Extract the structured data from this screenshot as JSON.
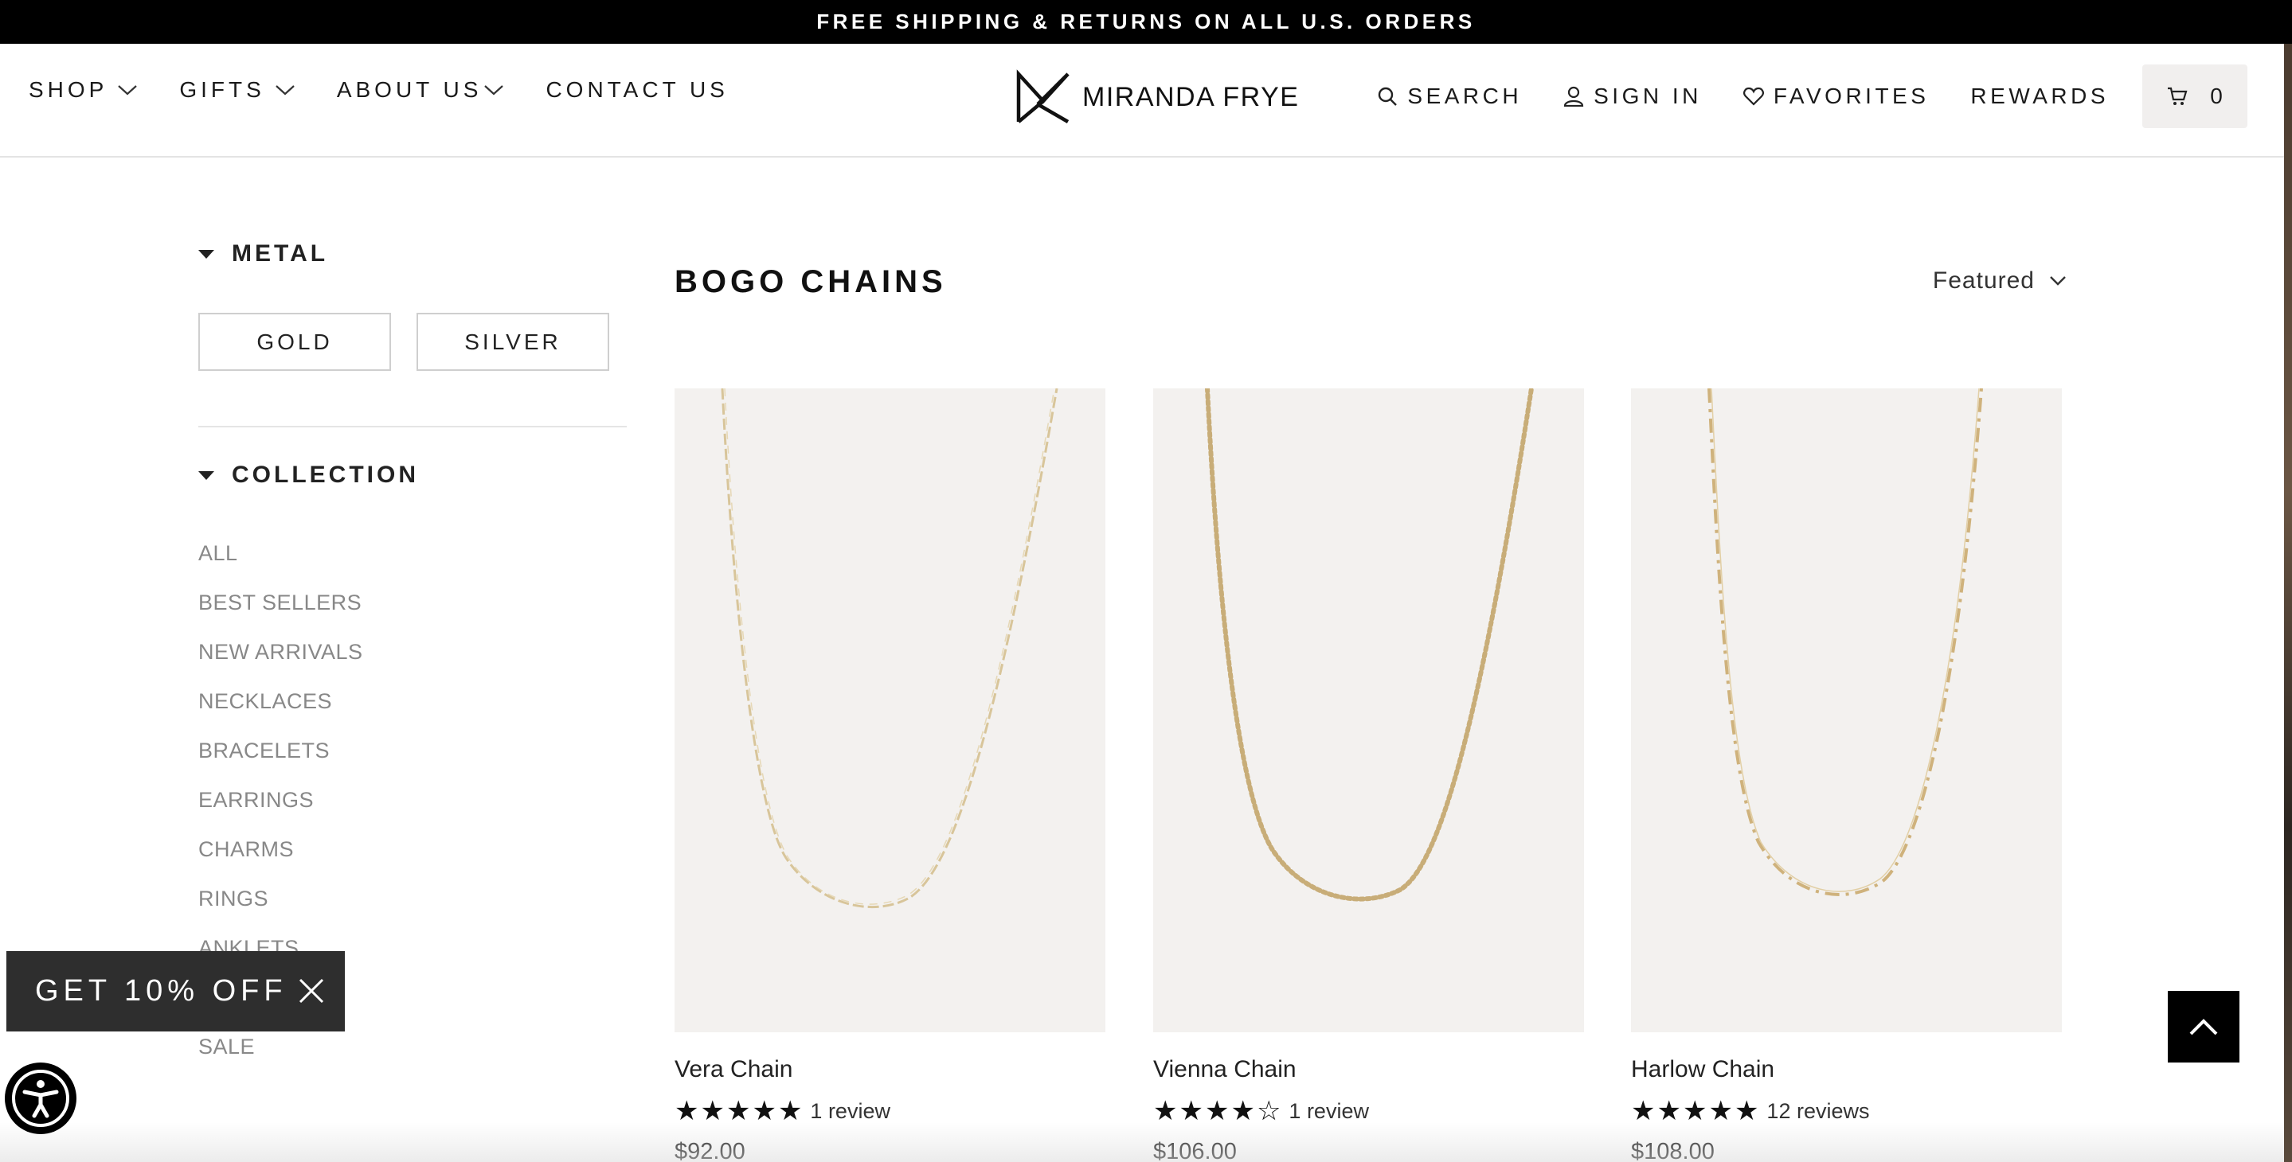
{
  "announcement": "FREE SHIPPING & RETURNS ON ALL U.S. ORDERS",
  "nav_left": [
    {
      "label": "SHOP",
      "has_dropdown": true
    },
    {
      "label": "GIFTS",
      "has_dropdown": true
    },
    {
      "label": "ABOUT US",
      "has_dropdown": true
    },
    {
      "label": "CONTACT US",
      "has_dropdown": false
    }
  ],
  "brand": {
    "name": "MIRANDA FRYE",
    "logo_icon": "mf-monogram-icon"
  },
  "nav_right": {
    "search": "SEARCH",
    "sign_in": "SIGN IN",
    "favorites": "FAVORITES",
    "rewards": "REWARDS",
    "cart_count": "0"
  },
  "filters": {
    "metal": {
      "title": "METAL",
      "options": [
        "GOLD",
        "SILVER"
      ]
    },
    "collection": {
      "title": "COLLECTION",
      "items": [
        "ALL",
        "BEST SELLERS",
        "NEW ARRIVALS",
        "NECKLACES",
        "BRACELETS",
        "EARRINGS",
        "CHARMS",
        "RINGS",
        "ANKLETS",
        "",
        "SALE"
      ]
    }
  },
  "main": {
    "title": "BOGO CHAINS",
    "sort_label": "Featured"
  },
  "products": [
    {
      "name": "Vera Chain",
      "rating": 5,
      "reviews": "1 review",
      "price": "$92.00",
      "chain_style": "paperclip"
    },
    {
      "name": "Vienna Chain",
      "rating": 4,
      "reviews": "1 review",
      "price": "$106.00",
      "chain_style": "bead"
    },
    {
      "name": "Harlow Chain",
      "rating": 5,
      "reviews": "12 reviews",
      "price": "$108.00",
      "chain_style": "station"
    }
  ],
  "promo": {
    "label": "GET 10% OFF"
  },
  "colors": {
    "gold": "#c9a76a",
    "image_bg": "#f3f1ef",
    "text_muted": "#888888"
  }
}
